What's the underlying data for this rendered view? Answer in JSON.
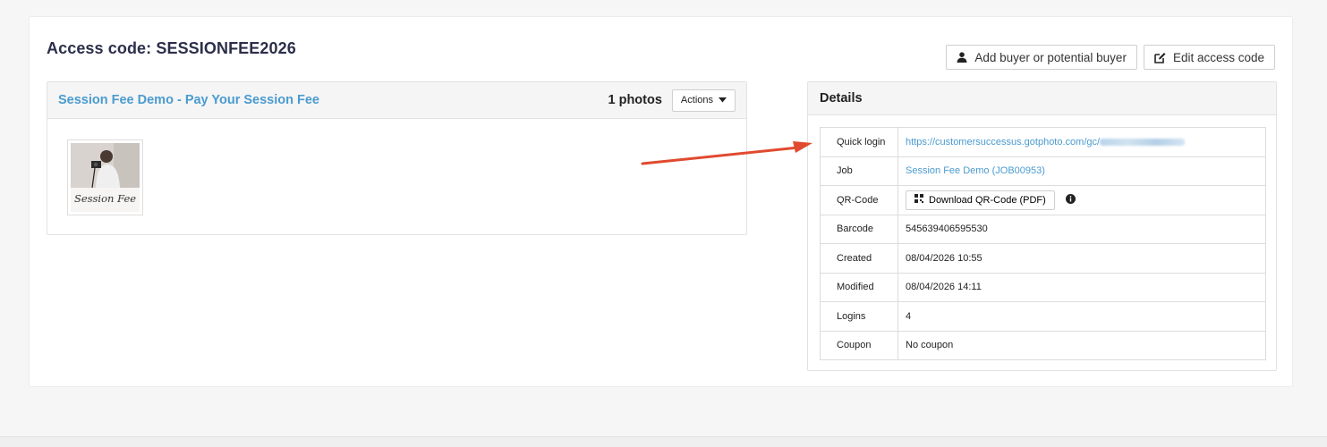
{
  "page": {
    "title": "Access code: SESSIONFEE2026"
  },
  "toolbar": {
    "add_buyer_label": "Add buyer or potential buyer",
    "edit_code_label": "Edit access code"
  },
  "gallery": {
    "title": "Session Fee Demo - Pay Your Session Fee",
    "photo_count": "1 photos",
    "actions_label": "Actions",
    "thumbnail_caption": "Session Fee"
  },
  "details": {
    "heading": "Details",
    "rows": [
      {
        "key": "Quick login",
        "value": "https://customersuccessus.gotphoto.com/gc/"
      },
      {
        "key": "Job",
        "value": "Session Fee Demo (JOB00953)"
      },
      {
        "key": "QR-Code",
        "value": "Download QR-Code (PDF)"
      },
      {
        "key": "Barcode",
        "value": "545639406595530"
      },
      {
        "key": "Created",
        "value": "08/04/2026 10:55"
      },
      {
        "key": "Modified",
        "value": "08/04/2026 14:11"
      },
      {
        "key": "Logins",
        "value": "4"
      },
      {
        "key": "Coupon",
        "value": "No coupon"
      }
    ]
  },
  "colors": {
    "link": "#4a9bcf",
    "title": "#2c2f4a",
    "annotation_arrow": "#e04a2f"
  },
  "icons": {
    "add_buyer": "user-icon",
    "edit_code": "edit-icon",
    "actions": "caret-down-icon",
    "qr": "qr-code-icon",
    "info": "info-icon"
  }
}
